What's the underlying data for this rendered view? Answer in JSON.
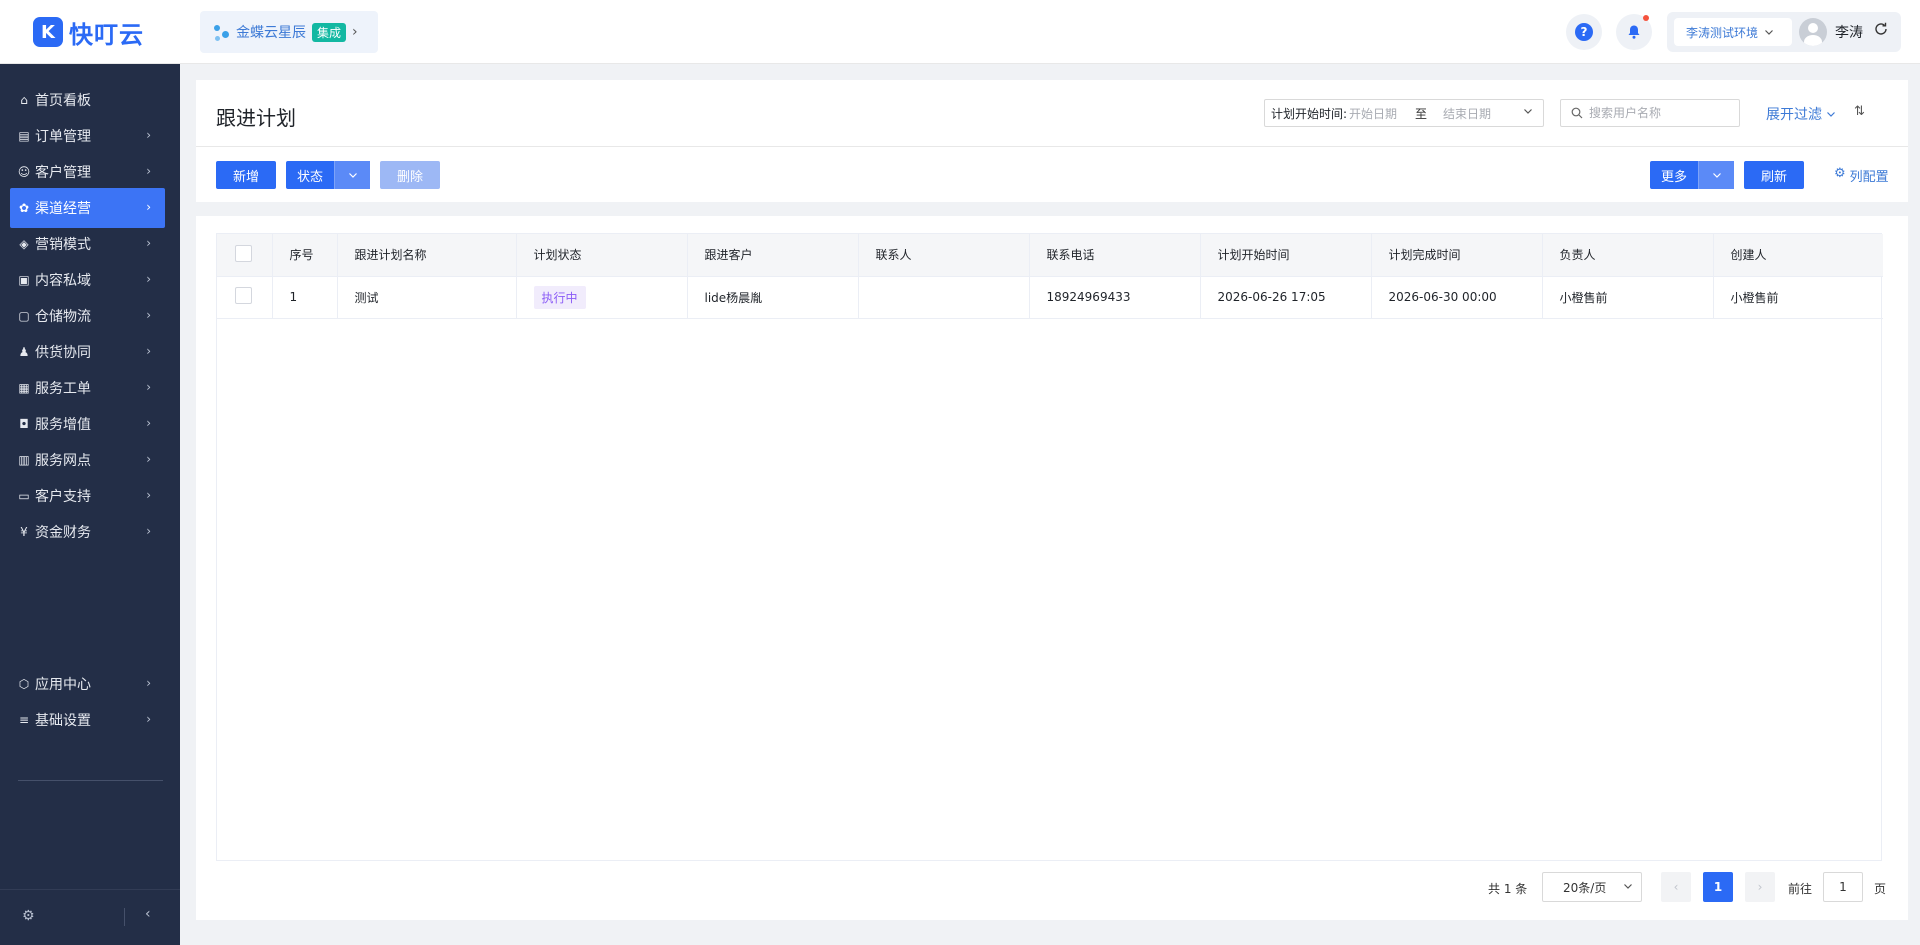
{
  "header": {
    "logo_mark": "K",
    "logo_text": "快叮云",
    "integration": {
      "name": "金蝶云星辰",
      "badge": "集成"
    },
    "environment": "李涛测试环境",
    "user_name": "李涛",
    "help_glyph": "?"
  },
  "sidebar": {
    "items": [
      {
        "label": "首页看板",
        "icon": "home-icon"
      },
      {
        "label": "订单管理",
        "icon": "order-icon"
      },
      {
        "label": "客户管理",
        "icon": "user-icon"
      },
      {
        "label": "渠道经营",
        "icon": "channel-icon",
        "active": true
      },
      {
        "label": "营销模式",
        "icon": "tag-icon"
      },
      {
        "label": "内容私域",
        "icon": "image-icon"
      },
      {
        "label": "仓储物流",
        "icon": "box-icon"
      },
      {
        "label": "供货协同",
        "icon": "people-icon"
      },
      {
        "label": "服务工单",
        "icon": "ticket-icon"
      },
      {
        "label": "服务增值",
        "icon": "bag-icon"
      },
      {
        "label": "服务网点",
        "icon": "store-icon"
      },
      {
        "label": "客户支持",
        "icon": "support-icon"
      },
      {
        "label": "资金财务",
        "icon": "yuan-icon"
      },
      {
        "label": "应用中心",
        "icon": "cube-icon"
      },
      {
        "label": "基础设置",
        "icon": "settings-list-icon"
      }
    ]
  },
  "page": {
    "title": "跟进计划",
    "filters": {
      "date_label": "计划开始时间:",
      "start_placeholder": "开始日期",
      "separator": "至",
      "end_placeholder": "结束日期",
      "search_placeholder": "搜索用户名称",
      "expand_label": "展开过滤"
    },
    "toolbar": {
      "add": "新增",
      "status": "状态",
      "delete": "删除",
      "more": "更多",
      "refresh": "刷新",
      "column_config": "列配置"
    }
  },
  "table": {
    "columns": [
      "序号",
      "跟进计划名称",
      "计划状态",
      "跟进客户",
      "联系人",
      "联系电话",
      "计划开始时间",
      "计划完成时间",
      "负责人",
      "创建人"
    ],
    "rows": [
      {
        "index": "1",
        "name": "测试",
        "status": "执行中",
        "customer": "lide杨晨胤",
        "contact": "",
        "phone": "18924969433",
        "start_time": "2026-06-26 17:05",
        "end_time": "2026-06-30 00:00",
        "owner": "小橙售前",
        "creator": "小橙售前"
      }
    ]
  },
  "pagination": {
    "total_text": "共 1 条",
    "page_size": "20条/页",
    "current_page": "1",
    "goto_label": "前往",
    "goto_value": "1",
    "page_suffix": "页"
  },
  "colors": {
    "primary": "#2b6af5",
    "sidebar_bg": "#232e47",
    "sidebar_active": "#3c74f5",
    "status_tag_text": "#8b5cf6",
    "status_tag_bg": "#f1ecfc",
    "integration_badge": "#13b8a2"
  }
}
